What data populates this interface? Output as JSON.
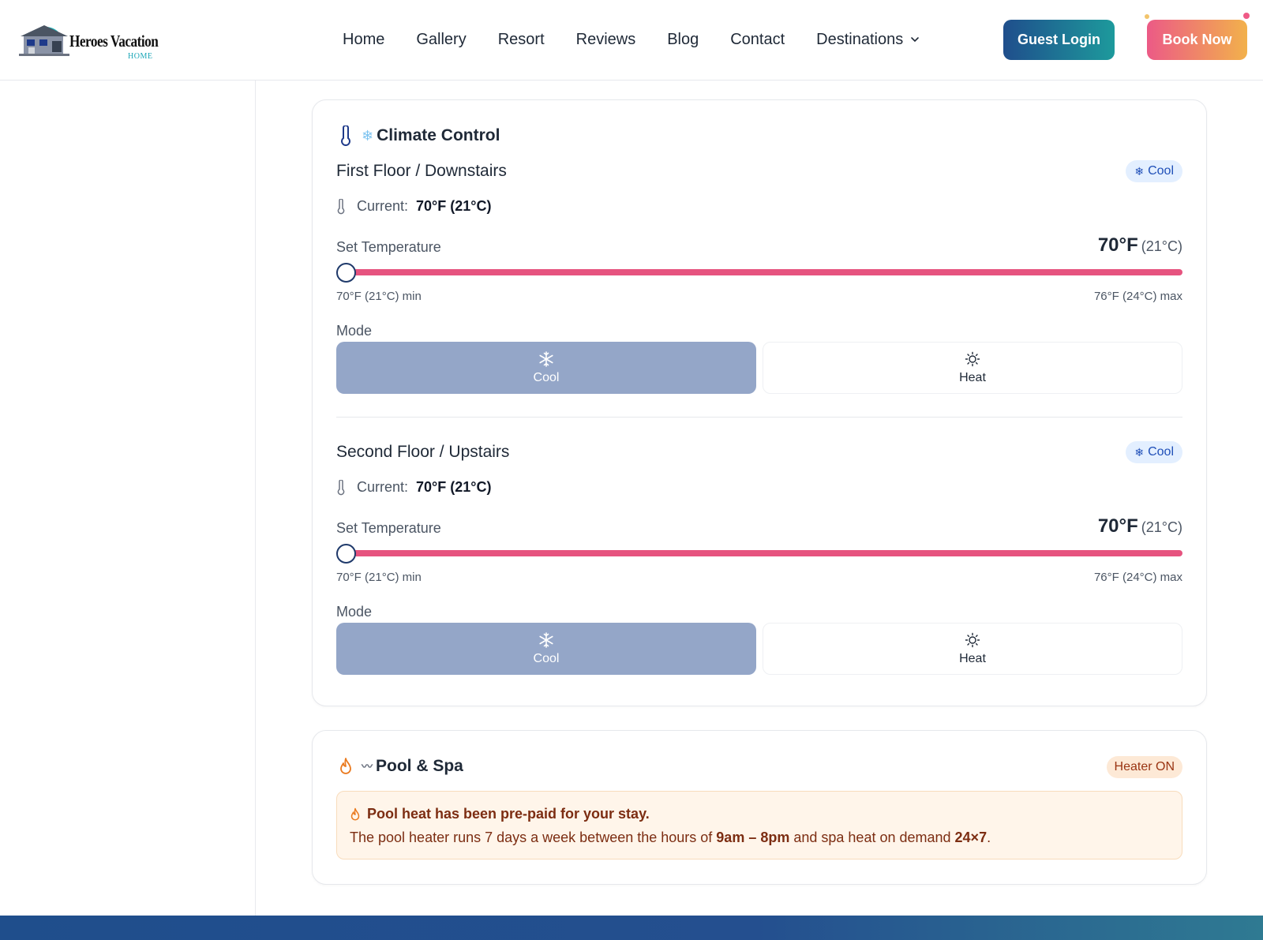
{
  "brand": {
    "name": "Heroes Vacation",
    "sub": "HOME"
  },
  "nav": {
    "items": [
      "Home",
      "Gallery",
      "Resort",
      "Reviews",
      "Blog",
      "Contact",
      "Destinations"
    ],
    "login_label": "Guest Login",
    "book_label": "Book Now"
  },
  "climate": {
    "title": "Climate Control",
    "zones": [
      {
        "name": "First Floor / Downstairs",
        "badge": "Cool",
        "current_label": "Current:",
        "current_value": "70°F (21°C)",
        "set_label": "Set Temperature",
        "set_f": "70°F",
        "set_c": "(21°C)",
        "min_label": "70°F (21°C) min",
        "max_label": "76°F (24°C) max",
        "slider_fraction": 0,
        "mode_label": "Mode",
        "modes": [
          "Cool",
          "Heat"
        ],
        "active_mode": "Cool"
      },
      {
        "name": "Second Floor / Upstairs",
        "badge": "Cool",
        "current_label": "Current:",
        "current_value": "70°F (21°C)",
        "set_label": "Set Temperature",
        "set_f": "70°F",
        "set_c": "(21°C)",
        "min_label": "70°F (21°C) min",
        "max_label": "76°F (24°C) max",
        "slider_fraction": 0,
        "mode_label": "Mode",
        "modes": [
          "Cool",
          "Heat"
        ],
        "active_mode": "Cool"
      }
    ]
  },
  "pool": {
    "title": "Pool & Spa",
    "badge": "Heater ON",
    "notice_title": "Pool heat has been pre-paid for your stay.",
    "notice_text_1": "The pool heater runs 7 days a week between the hours of ",
    "notice_hours": "9am – 8pm",
    "notice_text_2": " and spa heat on demand ",
    "notice_demand": "24×7",
    "notice_text_3": "."
  },
  "colors": {
    "accent_navy": "#1f4e8c",
    "accent_teal": "#1d9a9c",
    "slider_pink": "#e6537f",
    "cool_active": "#94a6c8",
    "heater_bg": "#fde9d6"
  },
  "icons": {
    "thermometer": "thermometer-icon",
    "snowflake": "snowflake-icon",
    "sun": "sun-icon",
    "flame": "flame-icon",
    "chevron": "chevron-down-icon"
  }
}
